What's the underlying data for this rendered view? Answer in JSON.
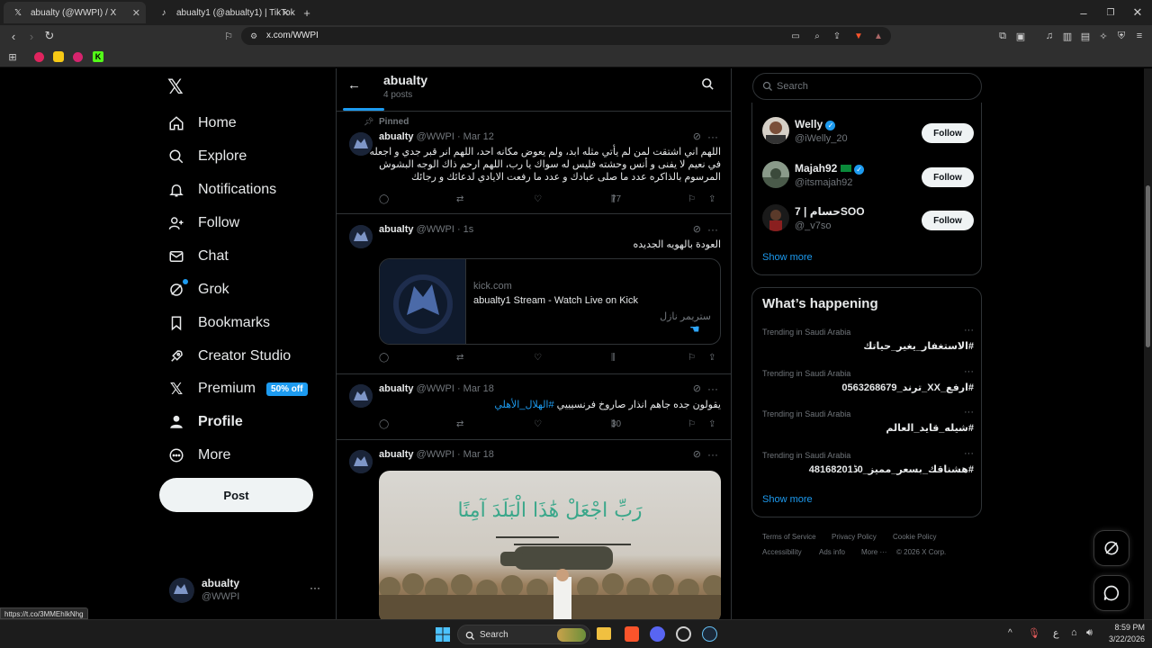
{
  "browser": {
    "tabs": [
      {
        "title": "abualty (@WWPI) / X",
        "active": true
      },
      {
        "title": "abualty1 (@abualty1) | TikTok",
        "active": false
      }
    ],
    "url": "x.com/WWPI",
    "status_url": "https://t.co/3MMEhIkNhg"
  },
  "header": {
    "name": "abualty",
    "posts": "4 posts"
  },
  "nav": {
    "home": "Home",
    "explore": "Explore",
    "notifications": "Notifications",
    "follow": "Follow",
    "chat": "Chat",
    "grok": "Grok",
    "bookmarks": "Bookmarks",
    "creator_studio": "Creator Studio",
    "premium": "Premium",
    "premium_badge": "50% off",
    "profile": "Profile",
    "more": "More",
    "post": "Post"
  },
  "account": {
    "name": "abualty",
    "handle": "@WWPI"
  },
  "tweets": [
    {
      "pinned_label": "Pinned",
      "name": "abualty",
      "meta": "@WWPI · Mar 12",
      "text_lines": [
        "اللهم اني اشتقت لمن لم يأتي مثله ابد، ولم يعوض مكانه احد، اللهم انر قبر جدي و اجعله",
        "في نعيم لا يفنى و أنس وحشته فليس له سواك يا رب، اللهم ارحم ذاك الوجه البشوش",
        "المرسوم بالذاكره عدد ما صلى عبادك و عدد ما رفعت الايادي لدعائك و رجائك"
      ],
      "views": "77"
    },
    {
      "name": "abualty",
      "meta": "@WWPI · 1s",
      "text": "العودة بالهويه الجديده",
      "card": {
        "domain": "kick.com",
        "title": "abualty1 Stream - Watch Live on Kick",
        "subtitle": "ستريمر نازل"
      }
    },
    {
      "name": "abualty",
      "meta": "@WWPI · Mar 18",
      "text": "يقولون جده جاهم انذار صاروخ فرنسيييي",
      "hashtag": "#الهلال_الأهلي",
      "views": "30"
    },
    {
      "name": "abualty",
      "meta": "@WWPI · Mar 18",
      "image_caption": "رَبِّ اجْعَلْ هَٰذَا الْبَلَدَ آمِنًا"
    }
  ],
  "right": {
    "search_placeholder": "Search",
    "who_to_follow": [
      {
        "name": "Welly",
        "handle": "@iWelly_20",
        "button": "Follow"
      },
      {
        "name": "Majah92",
        "handle": "@itsmajah92",
        "button": "Follow"
      },
      {
        "name": "7 | حسامSOO",
        "handle": "@_v7so",
        "button": "Follow"
      }
    ],
    "show_more": "Show more",
    "happening_title": "What’s happening",
    "trends": [
      {
        "context": "Trending in Saudi Arabia",
        "name": "#الاستغفار_يغير_حياتك"
      },
      {
        "context": "Trending in Saudi Arabia",
        "name": "#ارفع_XX_ترند_0563268679"
      },
      {
        "context": "Trending in Saudi Arabia",
        "name": "#شيله_قايد_العالم"
      },
      {
        "context": "Trending in Saudi Arabia",
        "name": "#هشناقك_بسعر_مميز_0ڈ48168201"
      }
    ],
    "show_more_2": "Show more",
    "footer": {
      "terms": "Terms of Service",
      "privacy": "Privacy Policy",
      "cookie": "Cookie Policy",
      "accessibility": "Accessibility",
      "ads": "Ads info",
      "more": "More ···",
      "copyright": "© 2026 X Corp."
    }
  },
  "taskbar": {
    "search": "Search",
    "time": "8:59 PM",
    "date": "3/22/2026",
    "lang": "ع"
  }
}
